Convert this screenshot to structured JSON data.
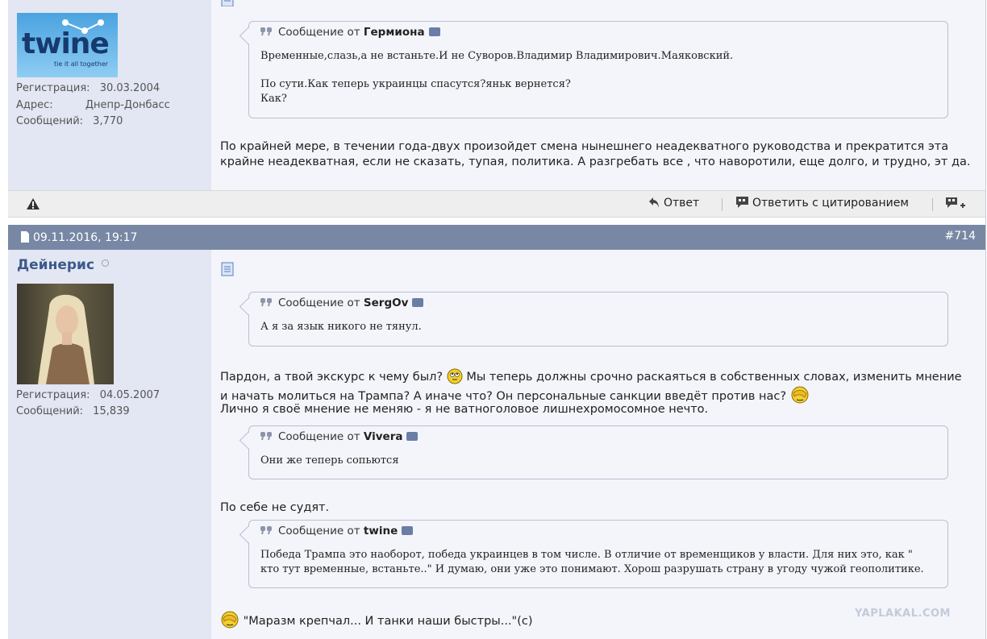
{
  "post1": {
    "user": {
      "avatar_text": "twine",
      "avatar_tagline": "tie it all together",
      "fields": [
        {
          "label": "Регистрация:",
          "value": "30.03.2004"
        },
        {
          "label": "Адрес:",
          "value": "Днепр-Донбасс"
        },
        {
          "label": "Сообщений:",
          "value": "3,770"
        }
      ]
    },
    "quote": {
      "prefix": "Сообщение от",
      "author": "Гермиона",
      "lines": [
        "Временные,слазь,а не встаньте.И не Суворов.Владимир Владимирович.Маяковский.",
        "",
        "По сути.Как теперь украинцы спасутся?яньк вернется?",
        "Как?"
      ]
    },
    "text": [
      "По крайней мере, в течении года-двух произойдет смена нынешнего неадекватного руководства и прекратится эта",
      "крайне неадекватная, если не сказать, тупая, политика. А разгребать все , что наворотили, еще долго, и трудно, эт да."
    ],
    "toolbar": {
      "reply": "Ответ",
      "reply_quote": "Ответить с цитированием"
    }
  },
  "post2": {
    "date": "09.11.2016, 19:17",
    "number": "#714",
    "user": {
      "name": "Дейнерис",
      "fields": [
        {
          "label": "Регистрация:",
          "value": "04.05.2007"
        },
        {
          "label": "Сообщений:",
          "value": "15,839"
        }
      ]
    },
    "quote1": {
      "prefix": "Сообщение от",
      "author": "SergOv",
      "text": "А я за язык никого не тянул."
    },
    "text1": [
      "Пардон, а твой экскурс к чему был?",
      "Мы теперь должны срочно раскаяться в собственных словах, изменить мнение",
      "и начать молиться на Трампа? А иначе что? Он персональные санкции введёт против нас?",
      "Лично я своё мнение не меняю - я не ватноголовое лишнехромосомное нечто."
    ],
    "quote2": {
      "prefix": "Сообщение от",
      "author": "Vivera",
      "text": "Они же теперь сопьются"
    },
    "text2": "По себе не судят.",
    "quote3": {
      "prefix": "Сообщение от",
      "author": "twine",
      "lines": [
        "Победа Трампа это наоборот, победа украинцев в том числе. В отличие от временщиков у власти. Для них это, как \"",
        "кто тут временные, встаньте..\" И думаю, они уже это понимают. Хорош разрушать страну в угоду чужой геополитике."
      ]
    },
    "text3": "\"Маразм крепчал... И танки наши быстры...\"(c)"
  },
  "watermark": "YAPLAKAL.COM"
}
